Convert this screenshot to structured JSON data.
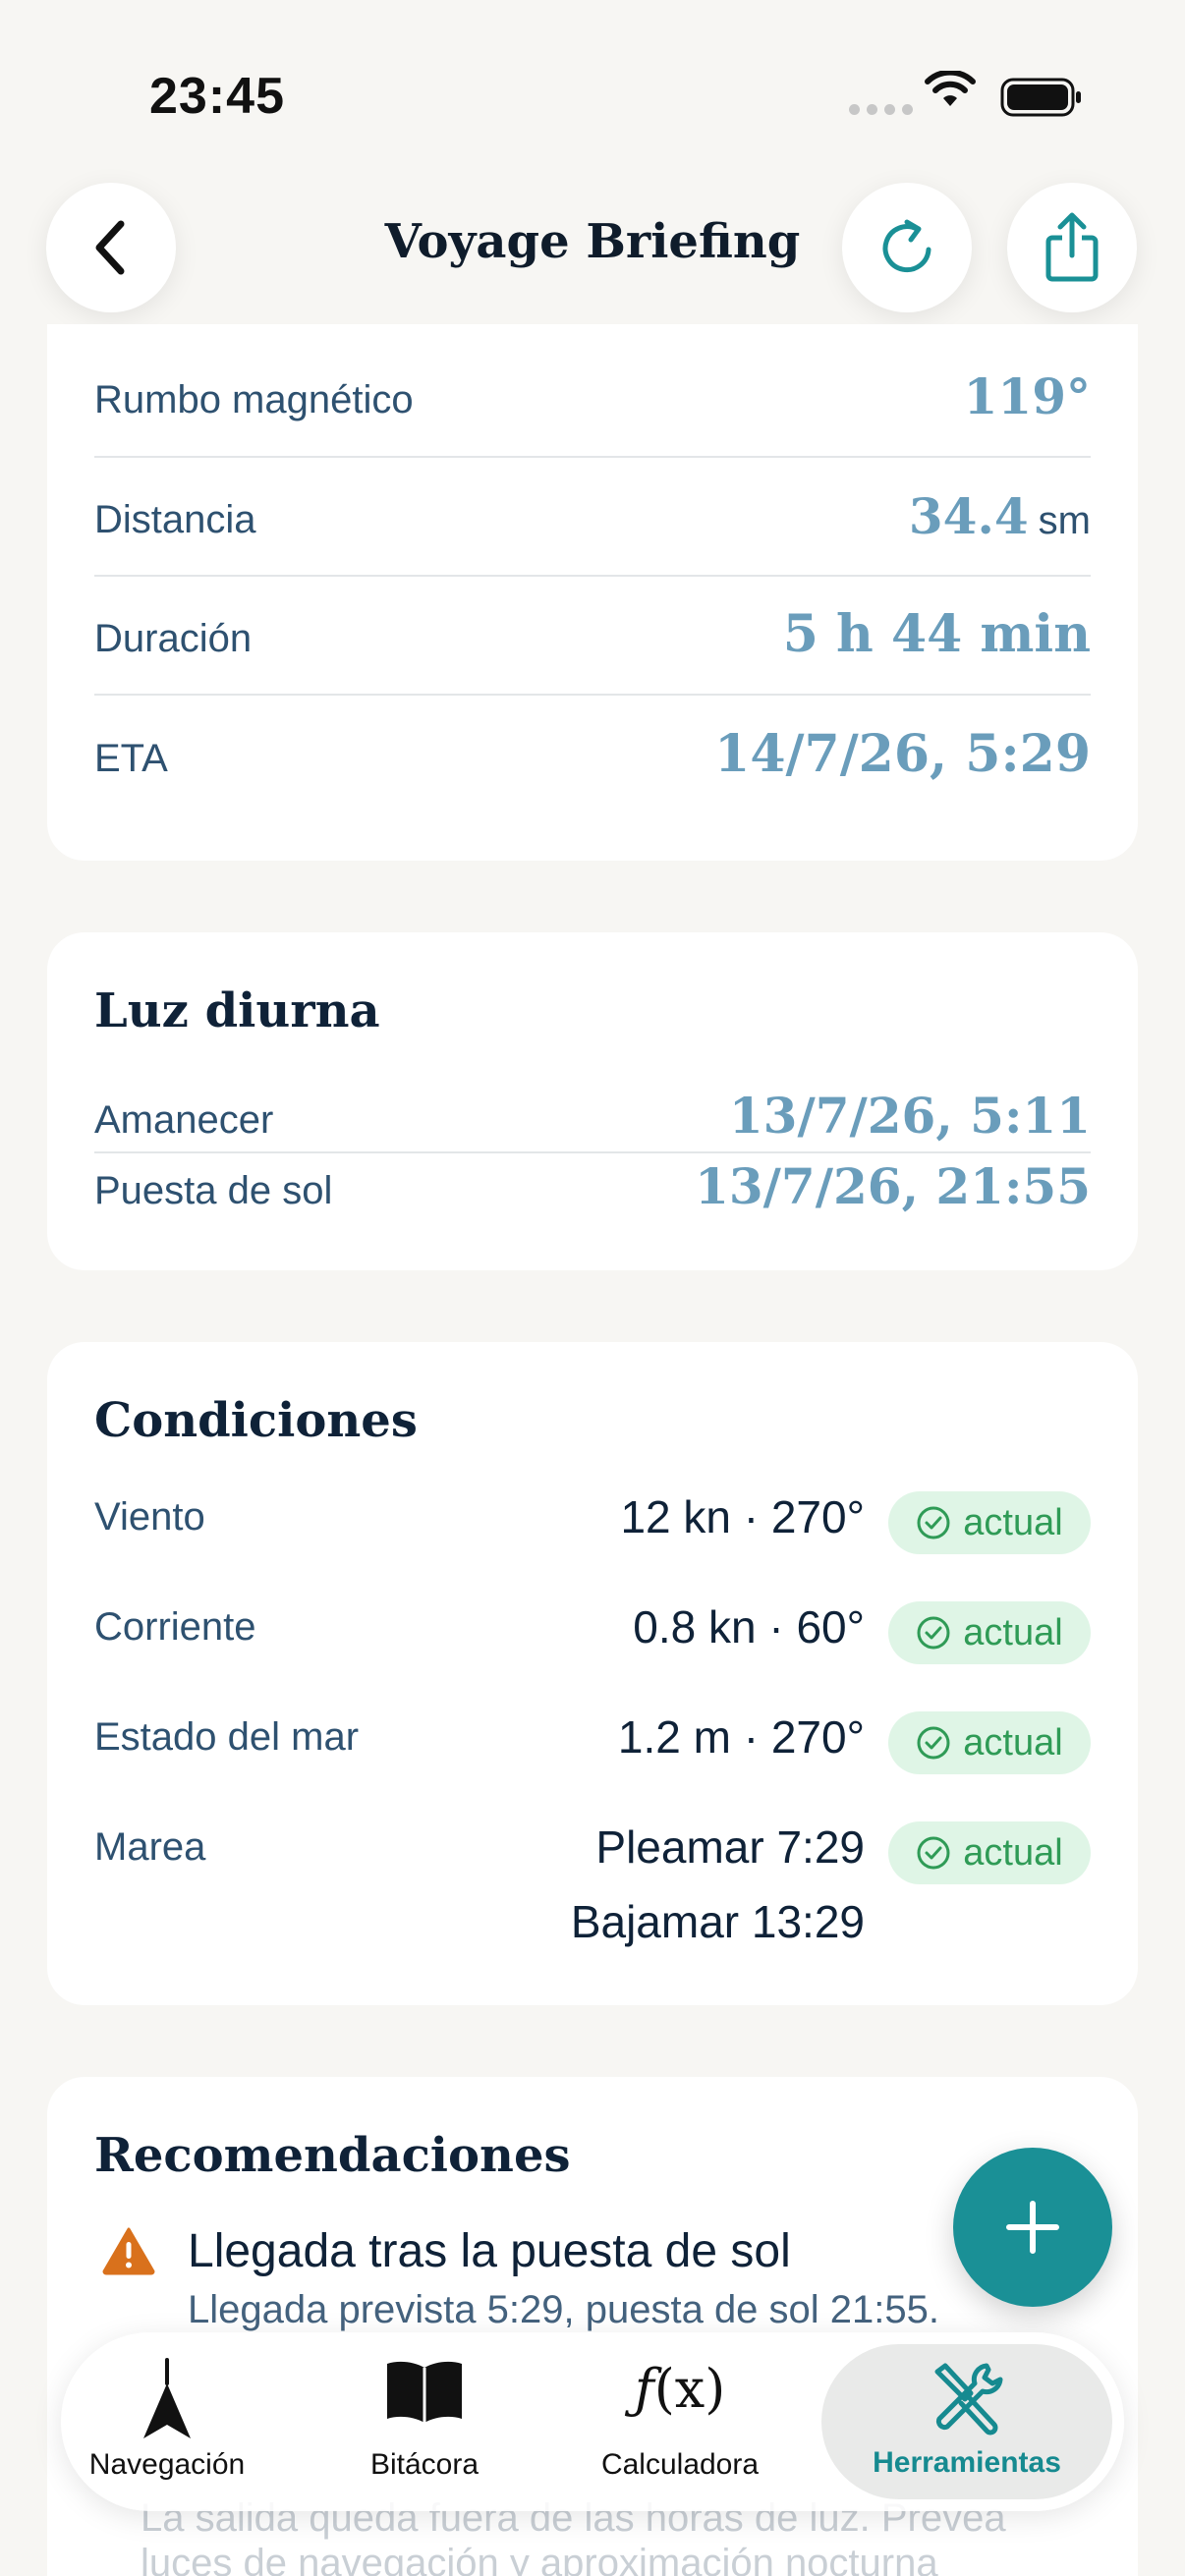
{
  "status_bar": {
    "time": "23:45"
  },
  "header": {
    "title": "Voyage Briefing"
  },
  "route": {
    "rows": [
      {
        "label": "Rumbo magnético",
        "value": "119°",
        "unit": ""
      },
      {
        "label": "Distancia",
        "value": "34.4",
        "unit": "sm"
      },
      {
        "label": "Duración",
        "value": "5 h 44 min",
        "unit": ""
      },
      {
        "label": "ETA",
        "value": "14/7/26, 5:29",
        "unit": ""
      }
    ]
  },
  "daylight": {
    "title": "Luz diurna",
    "rows": [
      {
        "label": "Amanecer",
        "value": "13/7/26, 5:11"
      },
      {
        "label": "Puesta de sol",
        "value": "13/7/26, 21:55"
      }
    ]
  },
  "conditions": {
    "title": "Condiciones",
    "rows": [
      {
        "label": "Viento",
        "value": "12 kn · 270°",
        "badge": "actual"
      },
      {
        "label": "Corriente",
        "value": "0.8 kn · 60°",
        "badge": "actual"
      },
      {
        "label": "Estado del mar",
        "value": "1.2 m · 270°",
        "badge": "actual"
      },
      {
        "label": "Marea",
        "value": "Pleamar 7:29",
        "value2": "Bajamar 13:29",
        "badge": "actual"
      }
    ]
  },
  "recommendations": {
    "title": "Recomendaciones",
    "items": [
      {
        "title": "Llegada tras la puesta de sol",
        "subtitle": "Llegada prevista 5:29, puesta de sol 21:55."
      }
    ],
    "partial_lines": [
      "La salida queda fuera de las horas de luz. Prevea",
      "luces de navegación y aproximación nocturna"
    ]
  },
  "tabbar": {
    "tabs": [
      {
        "label": "Navegación",
        "icon": "navigation-arrow-icon"
      },
      {
        "label": "Bitácora",
        "icon": "book-icon"
      },
      {
        "label": "Calculadora",
        "icon": "function-icon"
      },
      {
        "label": "Herramientas",
        "icon": "tools-icon"
      }
    ],
    "active_index": 3
  },
  "colors": {
    "accent": "#1a9096",
    "value_blue": "#6a9dbb",
    "badge_bg": "#dff5e6",
    "badge_fg": "#2f9b56",
    "warning": "#d9711c"
  }
}
